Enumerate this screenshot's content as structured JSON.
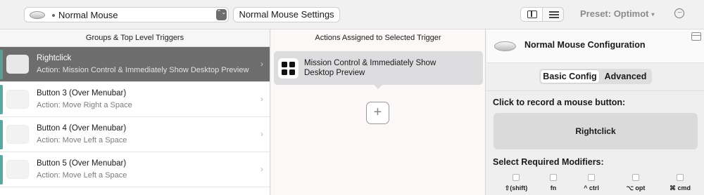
{
  "toolbar": {
    "device_select": "Normal Mouse",
    "settings_button": "Normal Mouse Settings",
    "preset_label": "Preset: Optimot",
    "preset_caret": "▾",
    "more_glyph": "···",
    "stepper_glyph": "⌃⌄"
  },
  "left_panel": {
    "header": "Groups & Top Level Triggers",
    "triggers": [
      {
        "title": "Rightclick",
        "action": "Action: Mission Control & Immediately Show Desktop Preview",
        "selected": true
      },
      {
        "title": "Button 3 (Over Menubar)",
        "action": "Action: Move Right a Space",
        "selected": false
      },
      {
        "title": "Button 4 (Over Menubar)",
        "action": "Action: Move Left a Space",
        "selected": false
      },
      {
        "title": "Button 5 (Over Menubar)",
        "action": "Action: Move Left a Space",
        "selected": false
      }
    ],
    "chevron": "›"
  },
  "middle_panel": {
    "header": "Actions Assigned to Selected Trigger",
    "action": {
      "label": "Mission Control & Immediately Show Desktop Preview",
      "icon": "mission-control-icon"
    },
    "add_glyph": "+"
  },
  "right_panel": {
    "title": "Normal Mouse Configuration",
    "tabs": [
      "Basic Config",
      "Advanced"
    ],
    "active_tab": "Basic Config",
    "record_label": "Click to record a mouse button:",
    "recorded_button": "Rightclick",
    "modifiers_label": "Select Required Modifiers:",
    "modifiers": [
      "⇧(shift)",
      "fn",
      "^ ctrl",
      "⌥ opt",
      "⌘ cmd"
    ]
  },
  "colors": {
    "selected_row": "#6d6d6d",
    "accent_bar": "#5aa9a0",
    "action_card": "#dddcde"
  }
}
